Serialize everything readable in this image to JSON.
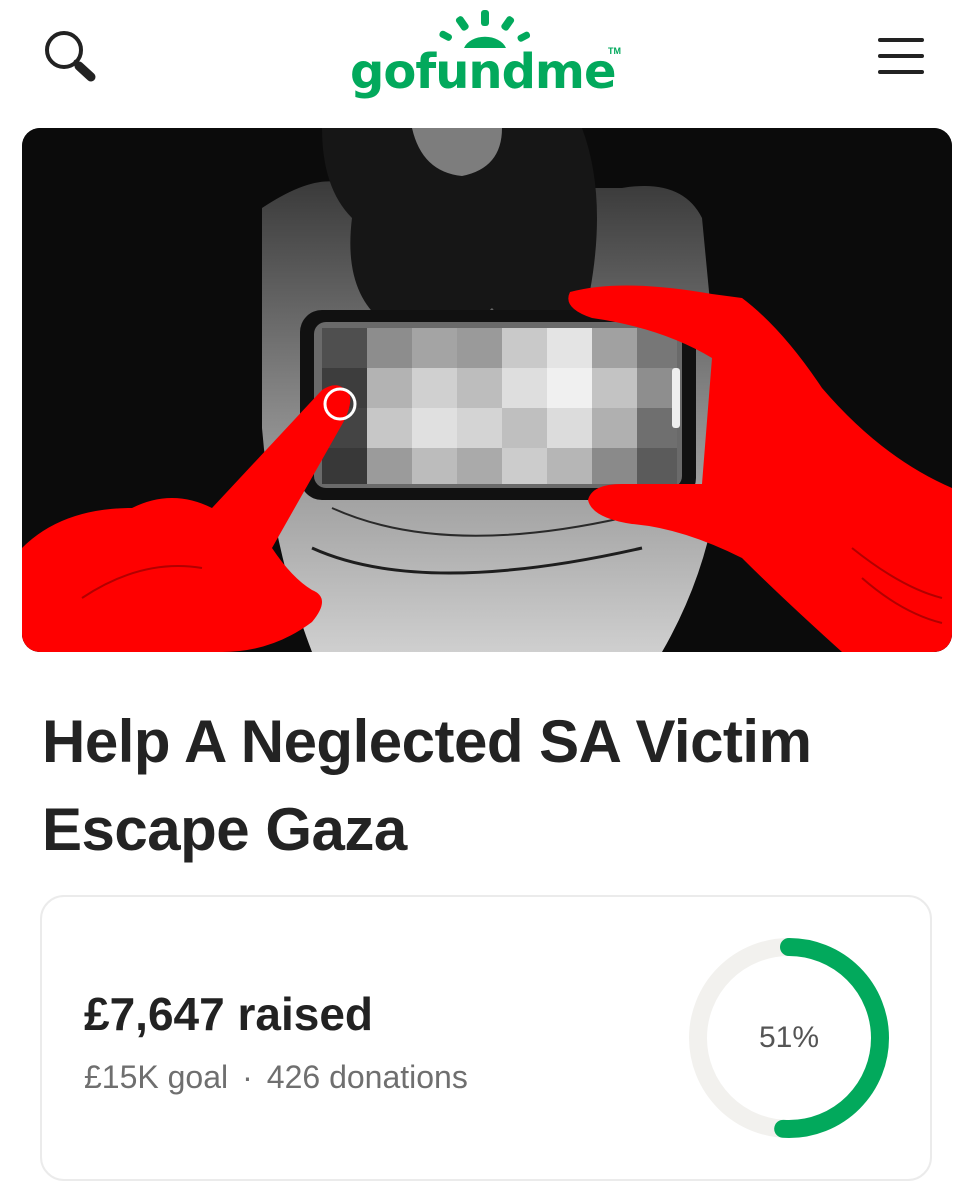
{
  "header": {
    "logo_text": "gofundme",
    "logo_tm": "TM",
    "brand_color": "#02a95c",
    "search_icon": "search-icon",
    "menu_icon": "hamburger-menu-icon"
  },
  "hero": {
    "image_icon": "campaign-illustration"
  },
  "campaign": {
    "title": "Help A Neglected SA Victim Escape Gaza",
    "raised": "£7,647 raised",
    "goal": "£15K goal",
    "separator": "·",
    "donations": "426 donations",
    "progress_label": "51%",
    "progress_fraction": 0.51,
    "progress_color": "#02a95c",
    "track_color": "#f2f1ee"
  }
}
